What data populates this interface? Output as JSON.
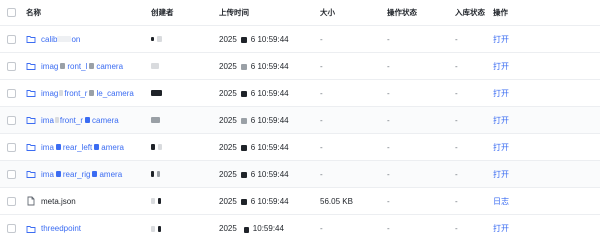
{
  "header": {
    "name": "名称",
    "creator": "创建者",
    "upload_time": "上传时间",
    "size": "大小",
    "op_status": "操作状态",
    "in_status": "入库状态",
    "action": "操作"
  },
  "rows": [
    {
      "name_start": "calib",
      "name_end": "on",
      "type": "folder",
      "time_start": "2025",
      "time_end": "6 10:59:44",
      "size": "-",
      "op_status": "-",
      "in_status": "-",
      "action": "打开"
    },
    {
      "name_start": "imag",
      "name_mid": "ront_l",
      "name_end": "camera",
      "type": "folder",
      "time_start": "2025",
      "time_end": "6 10:59:44",
      "size": "-",
      "op_status": "-",
      "in_status": "-",
      "action": "打开"
    },
    {
      "name_start": "imag",
      "name_mid": "front_r",
      "name_end": "le_camera",
      "type": "folder",
      "time_start": "2025",
      "time_end": "6 10:59:44",
      "size": "-",
      "op_status": "-",
      "in_status": "-",
      "action": "打开"
    },
    {
      "name_start": "ima",
      "name_mid": "front_r",
      "name_end": "camera",
      "type": "folder",
      "time_start": "2025",
      "time_end": "6 10:59:44",
      "size": "-",
      "op_status": "-",
      "in_status": "-",
      "action": "打开"
    },
    {
      "name_start": "ima",
      "name_mid": "rear_left",
      "name_end": "amera",
      "type": "folder",
      "time_start": "2025",
      "time_end": "6 10:59:44",
      "size": "-",
      "op_status": "-",
      "in_status": "-",
      "action": "打开"
    },
    {
      "name_start": "ima",
      "name_mid": "rear_rig",
      "name_end": "amera",
      "type": "folder",
      "time_start": "2025",
      "time_end": "6 10:59:44",
      "size": "-",
      "op_status": "-",
      "in_status": "-",
      "action": "打开"
    },
    {
      "name_start": "meta.json",
      "type": "file",
      "time_start": "2025",
      "time_end": "6 10:59:44",
      "size": "56.05 KB",
      "op_status": "-",
      "in_status": "-",
      "action": "日志"
    },
    {
      "name_start": "threedpoint",
      "type": "folder",
      "time_start": "2025",
      "time_end": "10:59:44",
      "size": "-",
      "op_status": "-",
      "in_status": "-",
      "action": "打开"
    }
  ],
  "icons": {
    "folder": "folder-icon",
    "file": "file-icon"
  },
  "colors": {
    "link": "#3b6cf2",
    "text": "#1f2329",
    "border": "#eceef1"
  }
}
